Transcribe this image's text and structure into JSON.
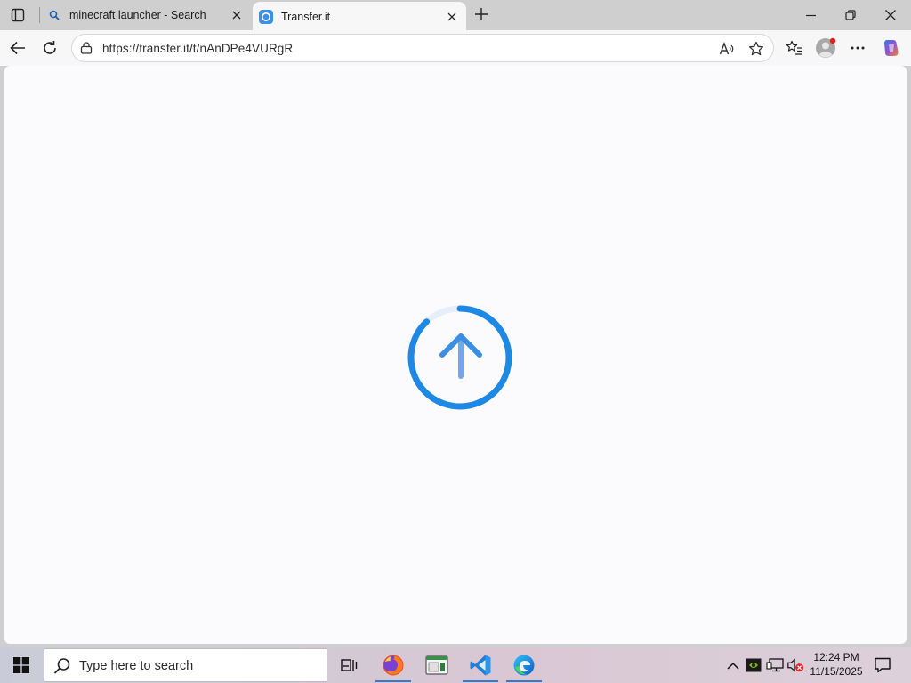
{
  "browser": {
    "tabs": [
      {
        "title": "minecraft launcher - Search",
        "active": false,
        "favicon": "search-icon"
      },
      {
        "title": "Transfer.it",
        "active": true,
        "favicon": "transfer-favicon"
      }
    ],
    "address_url": "https://transfer.it/t/nAnDPe4VURgR",
    "accent_color": "#1e88e5"
  },
  "page": {
    "loader_icon": "upload-arrow-icon",
    "loader_progress": 0.88
  },
  "taskbar": {
    "search_placeholder": "Type here to search",
    "pinned_apps": [
      "task-view-icon",
      "firefox-icon",
      "app-window-icon",
      "vscode-icon",
      "edge-icon"
    ],
    "clock_time": "12:24 PM",
    "clock_date": "11/15/2025"
  }
}
